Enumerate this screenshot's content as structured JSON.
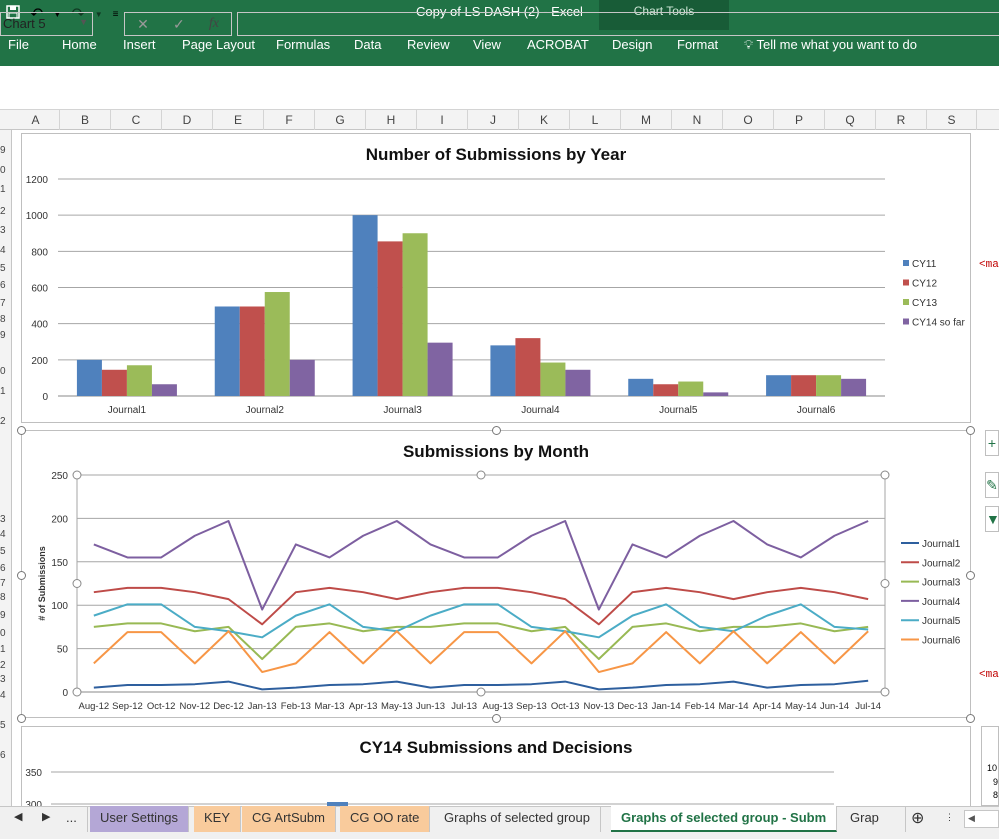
{
  "window": {
    "title": "Copy of LS DASH (2) - Excel",
    "context_tab_group": "Chart Tools"
  },
  "ribbon": {
    "tabs": [
      "File",
      "Home",
      "Insert",
      "Page Layout",
      "Formulas",
      "Data",
      "Review",
      "View",
      "ACROBAT",
      "Design",
      "Format"
    ],
    "tell_me": "Tell me what you want to do"
  },
  "formula_bar": {
    "name_box": "Chart 5",
    "fx_label": "fx",
    "value": ""
  },
  "columns": [
    "A",
    "B",
    "C",
    "D",
    "E",
    "F",
    "G",
    "H",
    "I",
    "J",
    "K",
    "L",
    "M",
    "N",
    "O",
    "P",
    "Q",
    "R",
    "S"
  ],
  "row_header_fragments": [
    "9",
    "0",
    "1",
    "2",
    "3",
    "4",
    "5",
    "6",
    "7",
    "8",
    "9",
    "0",
    "1",
    "2",
    "3",
    "4",
    "5",
    "6",
    "7",
    "8",
    "9",
    "0",
    "1",
    "2",
    "3",
    "4",
    "5",
    "6"
  ],
  "side_notes": {
    "note1": "<ma",
    "note2": "<ma"
  },
  "side_tick_labels": [
    "10",
    "9",
    "8"
  ],
  "sheet_tabs": [
    {
      "label": "...",
      "color": ""
    },
    {
      "label": "User Settings",
      "color": "#b4a7d6"
    },
    {
      "label": "KEY",
      "color": "#f9cb9c"
    },
    {
      "label": "CG ArtSubm",
      "color": "#f9cb9c"
    },
    {
      "label": "CG OO rate",
      "color": "#f9cb9c"
    },
    {
      "label": "Graphs of selected group",
      "color": ""
    },
    {
      "label": "Graphs of selected group - Subm",
      "color": ""
    },
    {
      "label": "Grap",
      "color": ""
    }
  ],
  "chart_data": [
    {
      "type": "bar",
      "title": "Number of Submissions by Year",
      "categories": [
        "Journal1",
        "Journal2",
        "Journal3",
        "Journal4",
        "Journal5",
        "Journal6"
      ],
      "ylim": [
        0,
        1200
      ],
      "yticks": [
        "0",
        "200",
        "400",
        "600",
        "800",
        "1000",
        "1200"
      ],
      "legend_position": "right",
      "series": [
        {
          "name": "CY11",
          "color": "#4f81bd",
          "values": [
            200,
            495,
            1000,
            280,
            95,
            115
          ]
        },
        {
          "name": "CY12",
          "color": "#c0504d",
          "values": [
            145,
            495,
            855,
            320,
            65,
            115
          ]
        },
        {
          "name": "CY13",
          "color": "#9bbb59",
          "values": [
            170,
            575,
            900,
            185,
            80,
            115
          ]
        },
        {
          "name": "CY14 so far",
          "color": "#8064a2",
          "values": [
            65,
            200,
            295,
            145,
            20,
            95
          ]
        }
      ]
    },
    {
      "type": "line",
      "title": "Submissions by Month",
      "ylabel": "# of Submissions",
      "categories": [
        "Aug-12",
        "Sep-12",
        "Oct-12",
        "Nov-12",
        "Dec-12",
        "Jan-13",
        "Feb-13",
        "Mar-13",
        "Apr-13",
        "May-13",
        "Jun-13",
        "Jul-13",
        "Aug-13",
        "Sep-13",
        "Oct-13",
        "Nov-13",
        "Dec-13",
        "Jan-14",
        "Feb-14",
        "Mar-14",
        "Apr-14",
        "May-14",
        "Jun-14",
        "Jul-14"
      ],
      "ylim": [
        0,
        250
      ],
      "yticks": [
        "0",
        "50",
        "100",
        "150",
        "200",
        "250"
      ],
      "legend_position": "right",
      "series": [
        {
          "name": "Journal1",
          "color": "#2e5f9e",
          "values": [
            5,
            8,
            8,
            9,
            12,
            3,
            5,
            8,
            9,
            12,
            5,
            8,
            8,
            9,
            12,
            3,
            5,
            8,
            9,
            12,
            5,
            8,
            9,
            13
          ]
        },
        {
          "name": "Journal2",
          "color": "#be4b48",
          "values": [
            115,
            120,
            120,
            115,
            107,
            78,
            115,
            120,
            115,
            107,
            115,
            120,
            120,
            115,
            107,
            78,
            115,
            120,
            115,
            107,
            115,
            120,
            115,
            107
          ]
        },
        {
          "name": "Journal3",
          "color": "#98b954",
          "values": [
            75,
            79,
            79,
            70,
            75,
            38,
            75,
            79,
            70,
            75,
            75,
            79,
            79,
            70,
            75,
            38,
            75,
            79,
            70,
            75,
            75,
            79,
            70,
            75
          ]
        },
        {
          "name": "Journal4",
          "color": "#7d5fa0",
          "values": [
            170,
            155,
            155,
            180,
            197,
            95,
            170,
            155,
            180,
            197,
            170,
            155,
            155,
            180,
            197,
            95,
            170,
            155,
            180,
            197,
            170,
            155,
            180,
            197
          ]
        },
        {
          "name": "Journal5",
          "color": "#4bacc6",
          "values": [
            88,
            101,
            101,
            75,
            70,
            63,
            88,
            101,
            75,
            70,
            88,
            101,
            101,
            75,
            70,
            63,
            88,
            101,
            75,
            70,
            88,
            101,
            75,
            72
          ]
        },
        {
          "name": "Journal6",
          "color": "#f79646",
          "values": [
            33,
            69,
            69,
            33,
            70,
            23,
            33,
            69,
            33,
            70,
            33,
            69,
            69,
            33,
            70,
            23,
            33,
            69,
            33,
            70,
            33,
            69,
            33,
            70
          ]
        }
      ]
    },
    {
      "type": "bar",
      "title": "CY14 Submissions and Decisions",
      "yticks": [
        "300",
        "350"
      ],
      "ylim": [
        0,
        350
      ]
    }
  ]
}
